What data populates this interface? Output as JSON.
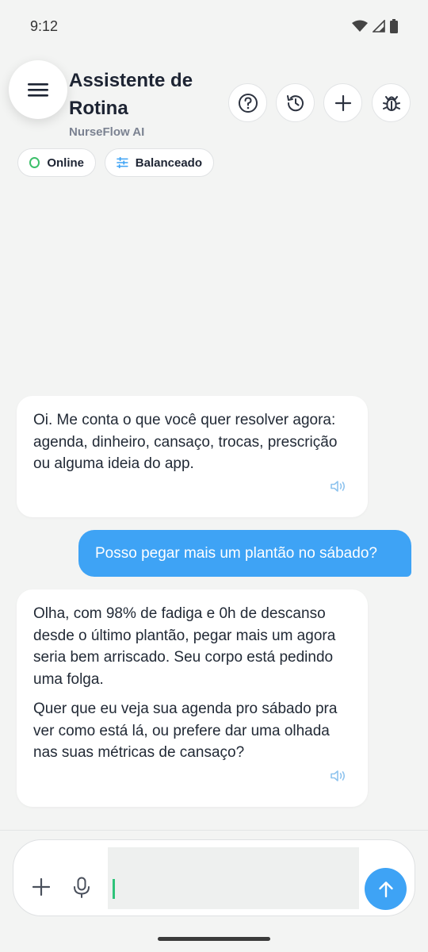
{
  "status_bar": {
    "time": "9:12",
    "icons": [
      "wifi-icon",
      "signal-icon",
      "battery-icon"
    ]
  },
  "header": {
    "title": "Assistente de Rotina",
    "subtitle": "NurseFlow AI",
    "buttons": [
      "help-icon",
      "history-icon",
      "plus-icon",
      "bug-icon"
    ],
    "chips": {
      "status": "Online",
      "mode": "Balanceado"
    }
  },
  "messages": [
    {
      "role": "assistant",
      "paragraphs": [
        "Oi. Me conta o que você quer resolver agora: agenda, dinheiro, cansaço, trocas, prescrição ou alguma ideia do app."
      ]
    },
    {
      "role": "user",
      "text": "Posso pegar mais um plantão no sábado?"
    },
    {
      "role": "assistant",
      "paragraphs": [
        "Olha, com 98% de fadiga e 0h de descanso desde o último plantão, pegar mais um agora seria bem arriscado. Seu corpo está pedindo uma folga.",
        "Quer que eu veja sua agenda pro sábado pra ver como está lá, ou prefere dar uma olhada nas suas métricas de cansaço?"
      ]
    }
  ],
  "composer": {
    "value": "",
    "placeholder": ""
  },
  "colors": {
    "accent": "#3ea3f5",
    "online": "#3cbf6a",
    "background": "#f3f4f3"
  }
}
